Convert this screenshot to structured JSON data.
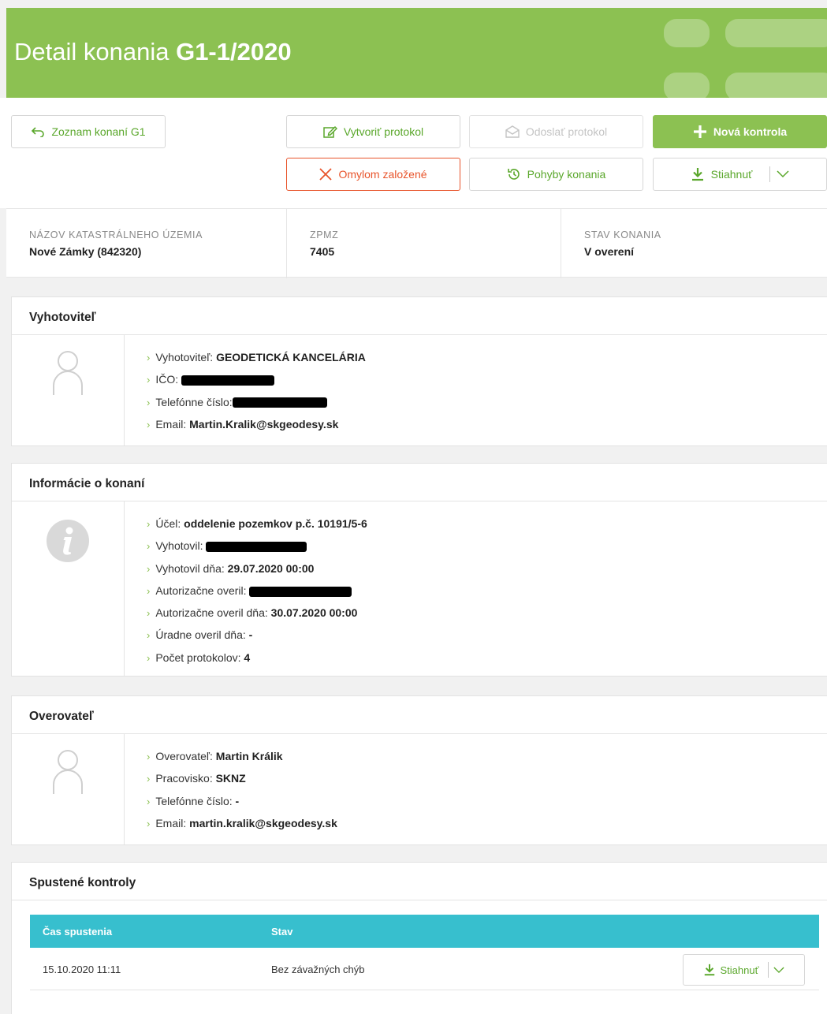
{
  "header": {
    "title_prefix": "Detail konania ",
    "title_id": "G1-1/2020"
  },
  "actions": {
    "back": "Zoznam konaní G1",
    "create_protocol": "Vytvoriť protokol",
    "send_protocol": "Odoslať protokol",
    "new_check": "Nová kontrola",
    "mistaken": "Omylom založené",
    "movements": "Pohyby konania",
    "download": "Stiahnuť"
  },
  "summary": [
    {
      "label": "Názov katastrálneho územia",
      "value": "Nové Zámky (842320)"
    },
    {
      "label": "ZPMZ",
      "value": "7405"
    },
    {
      "label": "Stav konania",
      "value": "V overení"
    }
  ],
  "producer": {
    "title": "Vyhotoviteľ",
    "items": [
      {
        "label": "Vyhotoviteľ: ",
        "value": "GEODETICKÁ KANCELÁRIA"
      },
      {
        "label": "IČO: ",
        "value": ""
      },
      {
        "label": "Telefónne číslo:",
        "value": ""
      },
      {
        "label": "Email: ",
        "value": "Martin.Kralik@skgeodesy.sk"
      }
    ]
  },
  "info": {
    "title": "Informácie o konaní",
    "items": [
      {
        "label": "Účel: ",
        "value": "oddelenie pozemkov p.č. 10191/5-6"
      },
      {
        "label": "Vyhotovil: ",
        "value": ""
      },
      {
        "label": "Vyhotovil dňa: ",
        "value": "29.07.2020 00:00"
      },
      {
        "label": "Autorizačne overil: ",
        "value": ""
      },
      {
        "label": "Autorizačne overil dňa: ",
        "value": "30.07.2020 00:00"
      },
      {
        "label": "Úradne overil dňa: ",
        "value": "-"
      },
      {
        "label": "Počet protokolov: ",
        "value": "4"
      }
    ]
  },
  "verifier": {
    "title": "Overovateľ",
    "items": [
      {
        "label": "Overovateľ: ",
        "value": "Martin Králik"
      },
      {
        "label": "Pracovisko: ",
        "value": "SKNZ"
      },
      {
        "label": "Telefónne číslo: ",
        "value": "-"
      },
      {
        "label": "Email: ",
        "value": "martin.kralik@skgeodesy.sk"
      }
    ]
  },
  "checks": {
    "title": "Spustené kontroly",
    "columns": [
      "Čas spustenia",
      "Stav"
    ],
    "rows": [
      {
        "time": "15.10.2020 11:11",
        "status": "Bez závažných chýb",
        "download": "Stiahnuť"
      }
    ]
  },
  "colors": {
    "brand": "#8cc152",
    "table_header": "#37bfce",
    "danger": "#e8542b"
  }
}
